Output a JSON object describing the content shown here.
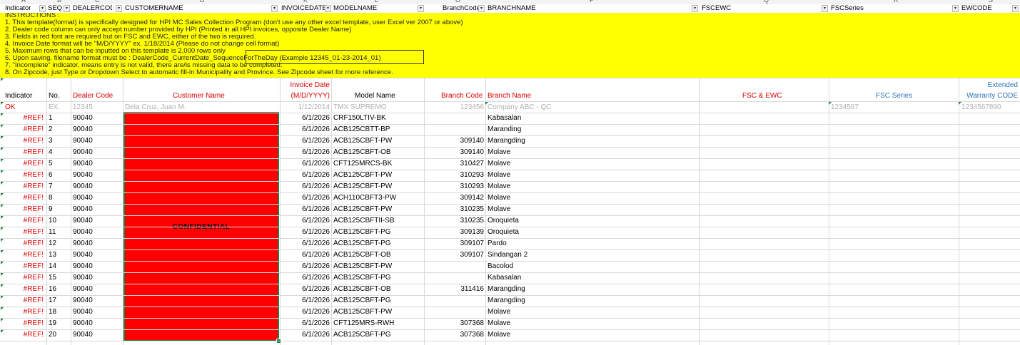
{
  "col_letters": [
    "A",
    "B",
    "C",
    "D",
    "K",
    "L",
    "O",
    "P",
    "Q",
    "R",
    "S"
  ],
  "filter_headers": [
    "Indicator",
    "SEQ",
    "DEALERCODE",
    "CUSTOMERNAME",
    "INVOICEDATE",
    "MODELNAME",
    "BranchCode",
    "BRANCHNAME",
    "FSCEWC",
    "FSCSeries",
    "EWCODE"
  ],
  "instructions": [
    "INSTRUCTIONS :",
    "1. This template(format) is specifically designed for HPI MC Sales Collection Program (don't use any other excel template, user Excel ver 2007 or above)",
    "2. Dealer code column can only accept number provided by HPI (Printed in all HPI invoices, opposite Dealer Name)",
    "3. Fields in red font are required but on FSC and EWC, either of the two is required.",
    "4. Invoice Date format will be \"M/D/YYYY\" ex. 1/18/2014  (Please do not change cell format)",
    "5. Maximum rows that can be inputted on this template is 2,000 rows only",
    "6. Upon saving, filename  format  must be : DealerCode_CurrentDate_SequenceForTheDay (Example 12345_01-23-2014_01)",
    "7. \"Incomplete\" indicator, means entry is not valid, there are/is missing data to be completed.",
    "8. On Zipcode, just Type or Dropdown Select to automatic fill-in Municipality and Province. See Zipcode sheet for more reference."
  ],
  "headers": {
    "indicator": "Indicator",
    "no": "No.",
    "dealer_code": "Dealer Code",
    "customer_name": "Customer Name",
    "invoice_date_1": "Invoice Date",
    "invoice_date_2": "(M/D/YYYY)",
    "model_name": "Model Name",
    "branch_code": "Branch Code",
    "branch_name": "Branch Name",
    "fsc_ewc": "FSC & EWC",
    "fsc_series": "FSC Series",
    "extended_1": "Extended",
    "extended_2": "Warranty CODE"
  },
  "example_row": {
    "indicator": "OK",
    "no": "EX.",
    "dealer_code": "12345",
    "customer_name": "Dela Cruz, Juan M.",
    "invoice_date": "1/12/2014",
    "model_name": "TMX SUPREMO",
    "branch_code": "123456",
    "branch_name": "Company ABC - QC",
    "fsc_series": "1234567",
    "ewcode": "1234567890"
  },
  "rows": [
    {
      "indicator": "#REF!",
      "no": "1",
      "dealer": "90040",
      "date": "6/1/2026",
      "model": "CRF150LTIV-BK",
      "bcode": "",
      "bname": "Kabasalan"
    },
    {
      "indicator": "#REF!",
      "no": "2",
      "dealer": "90040",
      "date": "6/1/2026",
      "model": "ACB125CBTT-BP",
      "bcode": "",
      "bname": "Maranding"
    },
    {
      "indicator": "#REF!",
      "no": "3",
      "dealer": "90040",
      "date": "6/1/2026",
      "model": "ACB125CBFT-PW",
      "bcode": "309140",
      "bname": "Marangding"
    },
    {
      "indicator": "#REF!",
      "no": "4",
      "dealer": "90040",
      "date": "6/1/2026",
      "model": "ACB125CBFT-OB",
      "bcode": "309140",
      "bname": "Molave"
    },
    {
      "indicator": "#REF!",
      "no": "5",
      "dealer": "90040",
      "date": "6/1/2026",
      "model": "CFT125MRCS-BK",
      "bcode": "310427",
      "bname": "Molave"
    },
    {
      "indicator": "#REF!",
      "no": "6",
      "dealer": "90040",
      "date": "6/1/2026",
      "model": "ACB125CBFT-PW",
      "bcode": "310293",
      "bname": "Molave"
    },
    {
      "indicator": "#REF!",
      "no": "7",
      "dealer": "90040",
      "date": "6/1/2026",
      "model": "ACB125CBFT-PW",
      "bcode": "310293",
      "bname": "Molave"
    },
    {
      "indicator": "#REF!",
      "no": "8",
      "dealer": "90040",
      "date": "6/1/2026",
      "model": "ACH110CBFT3-PW",
      "bcode": "309142",
      "bname": "Molave"
    },
    {
      "indicator": "#REF!",
      "no": "9",
      "dealer": "90040",
      "date": "6/1/2026",
      "model": "ACB125CBFT-PW",
      "bcode": "310235",
      "bname": "Molave"
    },
    {
      "indicator": "#REF!",
      "no": "10",
      "dealer": "90040",
      "date": "6/1/2026",
      "model": "ACB125CBFTII-SB",
      "bcode": "310235",
      "bname": "Oroquieta"
    },
    {
      "indicator": "#REF!",
      "no": "11",
      "dealer": "90040",
      "date": "6/1/2026",
      "model": "ACB125CBFT-PG",
      "bcode": "309139",
      "bname": "Oroquieta"
    },
    {
      "indicator": "#REF!",
      "no": "12",
      "dealer": "90040",
      "date": "6/1/2026",
      "model": "ACB125CBFT-PG",
      "bcode": "309107",
      "bname": "Pardo"
    },
    {
      "indicator": "#REF!",
      "no": "13",
      "dealer": "90040",
      "date": "6/1/2026",
      "model": "ACB125CBFT-OB",
      "bcode": "309107",
      "bname": "Sindangan 2"
    },
    {
      "indicator": "#REF!",
      "no": "14",
      "dealer": "90040",
      "date": "6/1/2026",
      "model": "ACB125CBFT-PW",
      "bcode": "",
      "bname": "Bacolod"
    },
    {
      "indicator": "#REF!",
      "no": "15",
      "dealer": "90040",
      "date": "6/1/2026",
      "model": "ACB125CBFT-PG",
      "bcode": "",
      "bname": "Kabasalan"
    },
    {
      "indicator": "#REF!",
      "no": "16",
      "dealer": "90040",
      "date": "6/1/2026",
      "model": "ACB125CBFT-OB",
      "bcode": "311416",
      "bname": "Marangding"
    },
    {
      "indicator": "#REF!",
      "no": "17",
      "dealer": "90040",
      "date": "6/1/2026",
      "model": "ACB125CBFT-PG",
      "bcode": "",
      "bname": "Marangding"
    },
    {
      "indicator": "#REF!",
      "no": "18",
      "dealer": "90040",
      "date": "6/1/2026",
      "model": "ACB125CBFT-PW",
      "bcode": "",
      "bname": "Molave"
    },
    {
      "indicator": "#REF!",
      "no": "19",
      "dealer": "90040",
      "date": "6/1/2026",
      "model": "CFT125MRS-RWH",
      "bcode": "307368",
      "bname": "Molave"
    },
    {
      "indicator": "#REF!",
      "no": "20",
      "dealer": "90040",
      "date": "6/1/2026",
      "model": "ACB125CBFT-PG",
      "bcode": "307368",
      "bname": "Molave"
    }
  ],
  "confidential_label": "CONFIDENTIAL",
  "colors": {
    "required_red": "#e00000",
    "header_blue": "#2e75b6",
    "instruction_yellow": "#ffff00",
    "confidential_red": "#ff0000",
    "selection_green": "#1e7a3d"
  }
}
